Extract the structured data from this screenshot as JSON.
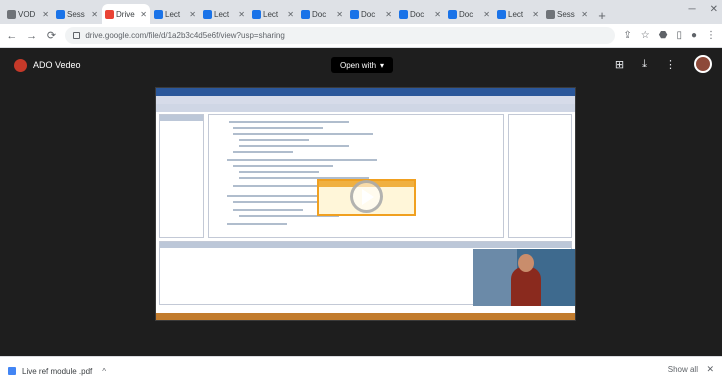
{
  "tabs": [
    {
      "title": "VOD",
      "favicon": "gray"
    },
    {
      "title": "Sess",
      "favicon": "blue"
    },
    {
      "title": "Drive",
      "favicon": "red",
      "active": true
    },
    {
      "title": "Lect",
      "favicon": "blue"
    },
    {
      "title": "Lect",
      "favicon": "blue"
    },
    {
      "title": "Lect",
      "favicon": "blue"
    },
    {
      "title": "Doc",
      "favicon": "blue"
    },
    {
      "title": "Doc",
      "favicon": "blue"
    },
    {
      "title": "Doc",
      "favicon": "blue"
    },
    {
      "title": "Doc",
      "favicon": "blue"
    },
    {
      "title": "Lect",
      "favicon": "blue"
    },
    {
      "title": "Sess",
      "favicon": "gray"
    }
  ],
  "toolbar": {
    "url": "drive.google.com/file/d/1a2b3c4d5e6f/view?usp=sharing"
  },
  "viewer": {
    "file_name": "ADO Vedeo",
    "open_with_label": "Open with",
    "open_with_chevron": "▾"
  },
  "downloads": {
    "item_name": "Live ref module .pdf",
    "show_all_label": "Show all"
  },
  "icons": {
    "back": "←",
    "forward": "→",
    "reload": "⟳",
    "tab_close": "✕",
    "new_tab": "+",
    "download_chevron": "^",
    "close": "✕"
  },
  "colors": {
    "viewer_bg": "#1e1e1e",
    "drive_red": "#c53929",
    "vs_blue": "#2b579a",
    "taskbar": "#c27c2e"
  }
}
